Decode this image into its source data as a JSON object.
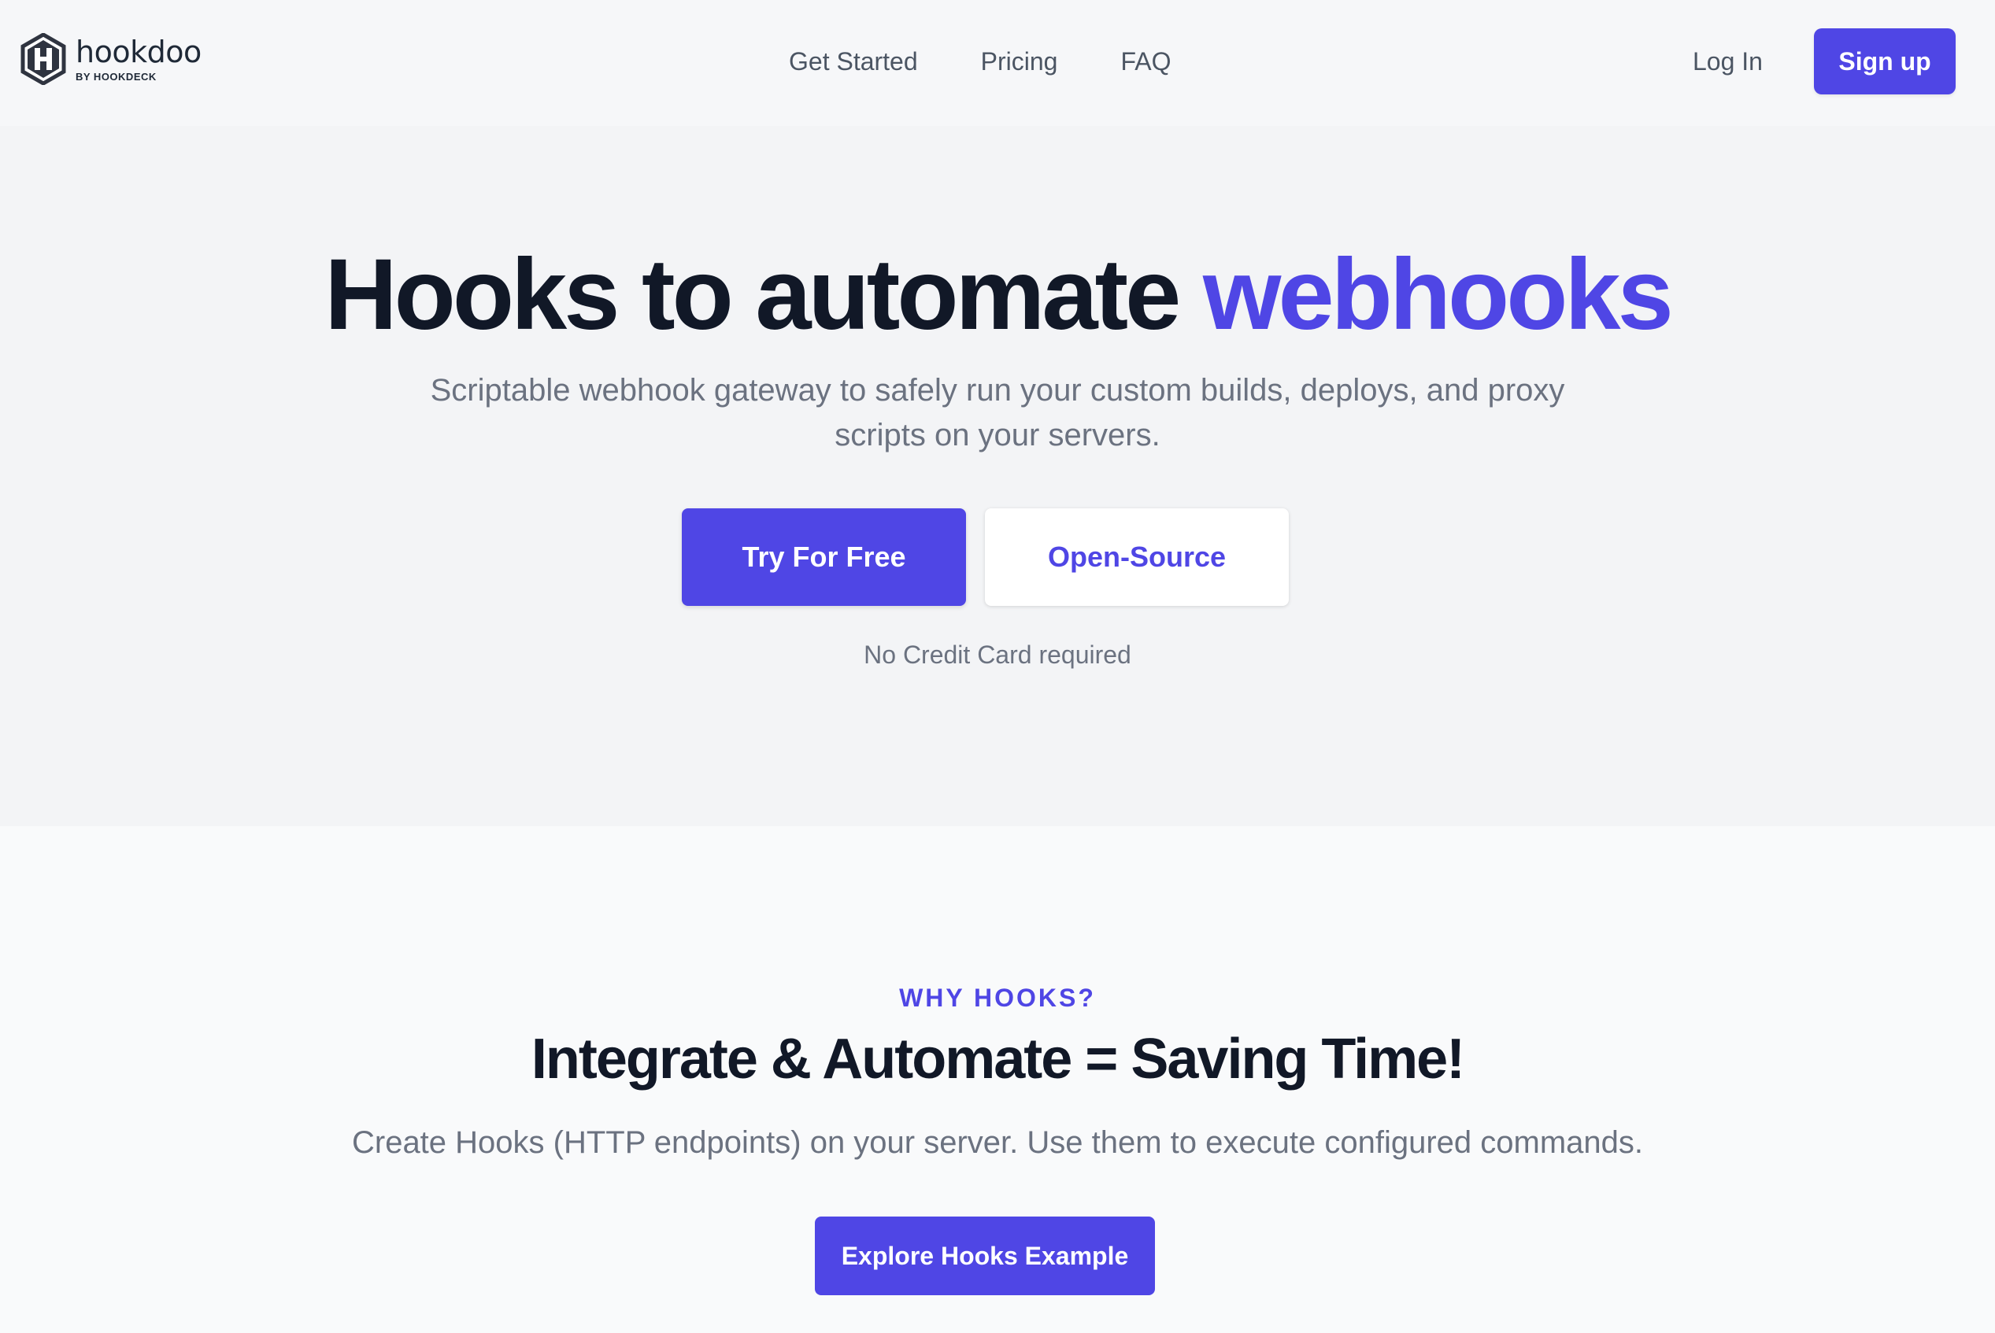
{
  "brand": {
    "name": "hookdoo",
    "sub": "BY HOOKDECK",
    "accent": "#4f46e5"
  },
  "nav": {
    "items": [
      {
        "label": "Get Started"
      },
      {
        "label": "Pricing"
      },
      {
        "label": "FAQ"
      }
    ],
    "login_label": "Log In",
    "signup_label": "Sign up"
  },
  "hero": {
    "title_main": "Hooks to automate",
    "title_accent": "webhooks",
    "subtitle": "Scriptable webhook gateway to safely run your custom builds, deploys, and proxy scripts on your servers.",
    "primary_cta": "Try For Free",
    "secondary_cta": "Open-Source",
    "note": "No Credit Card required"
  },
  "why": {
    "label": "WHY HOOKS?",
    "title": "Integrate & Automate = Saving Time!",
    "description": "Create Hooks (HTTP endpoints) on your server. Use them to execute configured commands.",
    "cta": "Explore Hooks Example"
  }
}
